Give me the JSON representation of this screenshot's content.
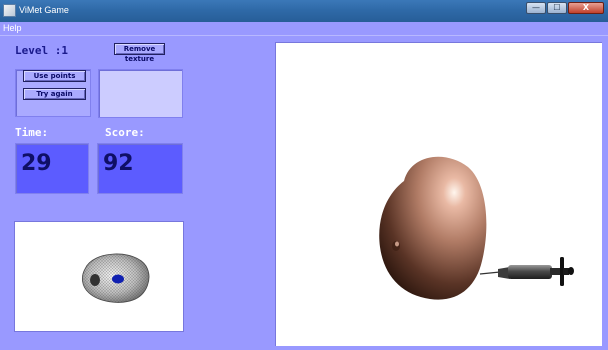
{
  "window": {
    "title": "ViMet Game",
    "controls": {
      "minimize": "—",
      "maximize": "☐",
      "close": "X"
    }
  },
  "menu": {
    "items": [
      "Help"
    ]
  },
  "level": {
    "label": "Level :1"
  },
  "buttons": {
    "remove_texture": "Remove texture",
    "use_points": "Use points",
    "try_again": "Try again"
  },
  "time": {
    "label": "Time:",
    "value": "29"
  },
  "score": {
    "label": "Score:",
    "value": "92"
  },
  "colors": {
    "background": "#9999ff",
    "value_box": "#5c5cff",
    "button": "#aaaaff",
    "title_bar": "#2f6aa8"
  },
  "icons": [
    "app-icon",
    "minimize-icon",
    "maximize-icon",
    "close-icon"
  ]
}
